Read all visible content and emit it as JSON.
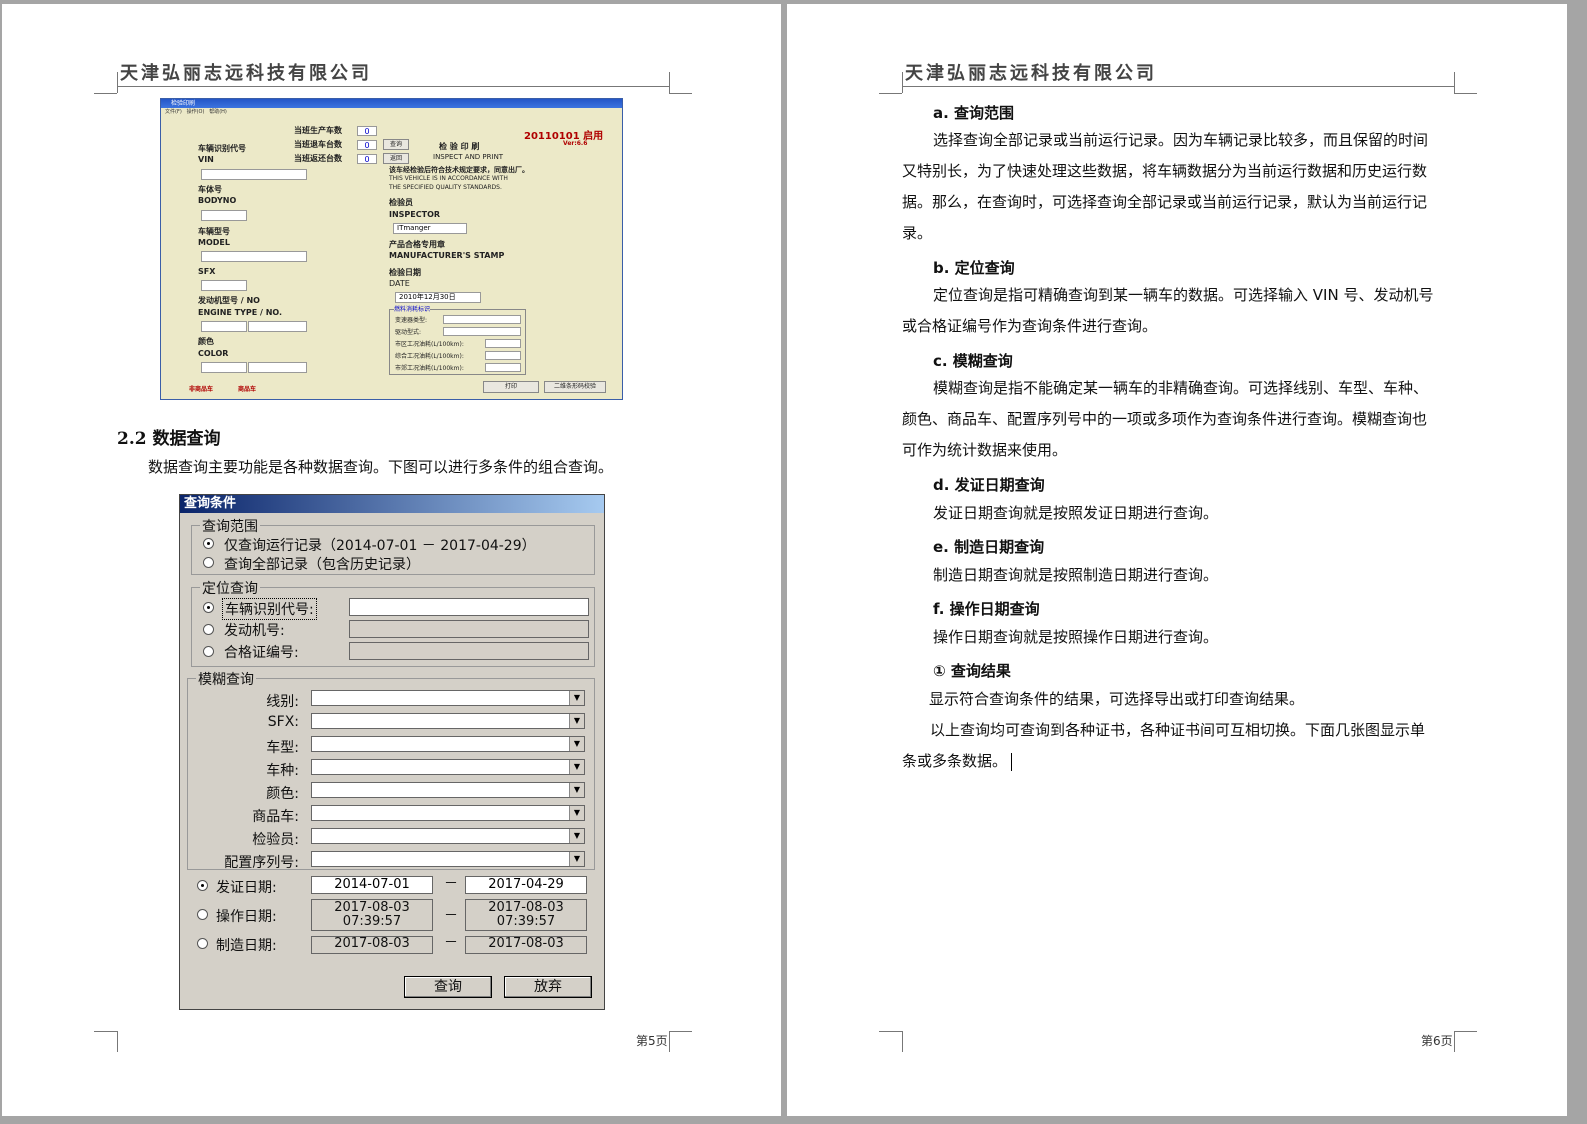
{
  "header": {
    "company": "天津弘丽志远科技有限公司"
  },
  "left_page": {
    "page_number": "第5页",
    "inspect_app": {
      "title": "检验印刷",
      "menu": [
        "文件(F)",
        "操作(O)",
        "帮助(H)"
      ],
      "counters": [
        {
          "label": "当班生产车数",
          "value": "0"
        },
        {
          "label": "当班退车台数",
          "value": "0"
        },
        {
          "label": "当班返还台数",
          "value": "0"
        }
      ],
      "query_btn": "查询",
      "return_btn": "返回",
      "version_date": "20110101 启用",
      "version": "Ver:6.6",
      "fields_left": [
        {
          "cn": "车辆识别代号",
          "en": "VIN"
        },
        {
          "cn": "车体号",
          "en": "BODYNO"
        },
        {
          "cn": "车辆型号",
          "en": "MODEL"
        },
        {
          "cn": "",
          "en": "SFX"
        },
        {
          "cn": "发动机型号 / NO",
          "en": "ENGINE TYPE / NO."
        },
        {
          "cn": "颜色",
          "en": "COLOR"
        }
      ],
      "center_title": "检 验 印 刷",
      "center_title_en": "INSPECT AND PRINT",
      "compliance_cn": "该车经检验后符合技术规定要求，同意出厂。",
      "compliance_en_1": "THIS VEHICLE IS IN ACCORDANCE WITH",
      "compliance_en_2": "THE SPECIFIED QUALITY STANDARDS.",
      "inspector_cn": "检验员",
      "inspector_en": "INSPECTOR",
      "inspector_value": "ITmanger",
      "stamp_cn": "产品合格专用章",
      "stamp_en": "MANUFACTURER'S STAMP",
      "date_cn": "检验日期",
      "date_en": "DATE",
      "date_value": "2010年12月30日",
      "fuel_group": "燃料消耗标识",
      "fuel_rows": [
        "变速器类型:",
        "驱动型式:",
        "市区工况油耗(L/100km):",
        "综合工况油耗(L/100km):",
        "市郊工况油耗(L/100km):"
      ],
      "radio_1": "非商品车",
      "radio_2": "商品车",
      "print_btn": "打印",
      "barcode_btn": "二维条形码校验"
    },
    "section_heading": "2.2 数据查询",
    "intro": "数据查询主要功能是各种数据查询。下图可以进行多条件的组合查询。",
    "query_dialog": {
      "title": "查询条件",
      "range_group": "查询范围",
      "range_opt1": "仅查询运行记录（2014-07-01 － 2017-04-29）",
      "range_opt2": "查询全部记录（包含历史记录）",
      "locate_group": "定位查询",
      "locate_opt1": "车辆识别代号:",
      "locate_opt2": "发动机号:",
      "locate_opt3": "合格证编号:",
      "fuzzy_group": "模糊查询",
      "fuzzy_labels": [
        "线别:",
        "SFX:",
        "车型:",
        "车种:",
        "颜色:",
        "商品车:",
        "检验员:",
        "配置序列号:"
      ],
      "date_rows": [
        {
          "label": "发证日期:",
          "from": "2014-07-01",
          "to": "2017-04-29"
        },
        {
          "label": "操作日期:",
          "from": "2017-08-03 07:39:57",
          "to": "2017-08-03 07:39:57"
        },
        {
          "label": "制造日期:",
          "from": "2017-08-03",
          "to": "2017-08-03"
        }
      ],
      "date_sep": "－",
      "query_btn": "查询",
      "cancel_btn": "放弃"
    }
  },
  "right_page": {
    "page_number": "第6页",
    "a_title": "a. 查询范围",
    "a_text": [
      "选择查询全部记录或当前运行记录。因为车辆记录比较多，而且保留的时间",
      "又特别长，为了快速处理这些数据，将车辆数据分为当前运行数据和历史运行数",
      "据。那么，在查询时，可选择查询全部记录或当前运行记录，默认为当前运行记",
      "录。"
    ],
    "b_title": "b. 定位查询",
    "b_text": [
      "定位查询是指可精确查询到某一辆车的数据。可选择输入 VIN 号、发动机号",
      "或合格证编号作为查询条件进行查询。"
    ],
    "c_title": "c. 模糊查询",
    "c_text": [
      "模糊查询是指不能确定某一辆车的非精确查询。可选择线别、车型、车种、",
      "颜色、商品车、配置序列号中的一项或多项作为查询条件进行查询。模糊查询也",
      "可作为统计数据来使用。"
    ],
    "d_title": "d. 发证日期查询",
    "d_text": "发证日期查询就是按照发证日期进行查询。",
    "e_title": "e. 制造日期查询",
    "e_text": "制造日期查询就是按照制造日期进行查询。",
    "f_title": "f. 操作日期查询",
    "f_text": "操作日期查询就是按照操作日期进行查询。",
    "g_title": "① 查询结果",
    "g_text": "显示符合查询条件的结果，可选择导出或打印查询结果。",
    "h_text": [
      "以上查询均可查询到各种证书，各种证书间可互相切换。下面几张图显示单",
      "条或多条数据。"
    ]
  }
}
